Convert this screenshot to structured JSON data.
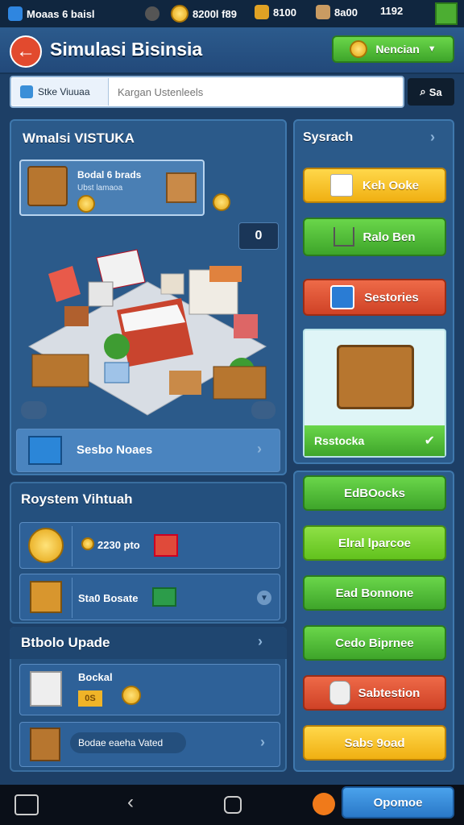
{
  "status_bar": {
    "app_label": "Moaas 6 baisl",
    "coins": "8200l f89",
    "crates": "8100",
    "boxes": "8a00",
    "time": "1192"
  },
  "header": {
    "title": "Simulasi Bisinsia",
    "top_button": "Nencian"
  },
  "search": {
    "tab_label": "Stke Viuuaa",
    "placeholder": "Kargan Ustenleels",
    "button_label": "Sa"
  },
  "left_panel": {
    "title": "Wmalsi VISTUKA",
    "featured_card": {
      "title": "Bodal 6 brads",
      "subtitle": "Ubst lamaoa"
    },
    "scene_counter": "0",
    "action_row_label": "Sesbo Noaes"
  },
  "right_panel": {
    "title": "Sysrach",
    "buttons": [
      "Keh Ooke",
      "Ralo Ben",
      "Sestories"
    ],
    "showcase_label": "Rsstocka"
  },
  "system_section": {
    "title": "Roystem Vihtuah",
    "rows": [
      {
        "label": "2230 pto",
        "icon": "coin-bag-icon"
      },
      {
        "label": "Sta0 Bosate",
        "icon": "crate-icon"
      }
    ]
  },
  "upgrade_section": {
    "title": "Btbolo Upade",
    "rows": [
      {
        "label": "Bockal",
        "sub": "0S"
      },
      {
        "label": "Bodae eaeha Vated"
      }
    ]
  },
  "action_buttons": [
    "EdBOocks",
    "Elral lparcoe",
    "Ead Bonnone",
    "Cedo Biprnee",
    "Sabtestion",
    "Sabs 9oad"
  ],
  "bottom_nav": {
    "confirm_label": "Opomoe"
  },
  "colors": {
    "green": "#4fb833",
    "yellow": "#f5c524",
    "red": "#d9502f",
    "background": "#1d3f66"
  }
}
